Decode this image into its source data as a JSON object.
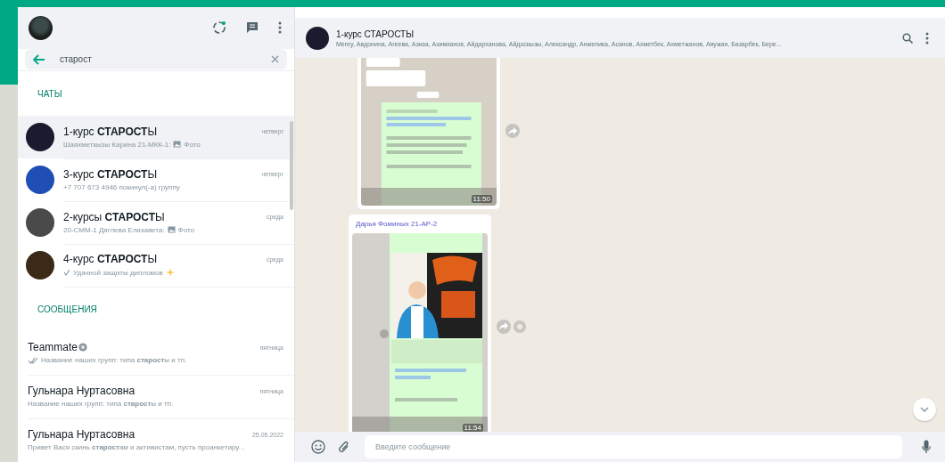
{
  "sidebar": {
    "search": {
      "value": "старост"
    },
    "sections": [
      {
        "title": "ЧАТЫ",
        "kind": "chats",
        "items": [
          {
            "name": "1-курс **СТАРОСТ**Ы",
            "time": "четверг",
            "selected": true,
            "color": "#1c1a2e",
            "sender": "Шаяхметкызы Карина 21-МКК-1: ",
            "photo": true,
            "text": "Фото"
          },
          {
            "name": "3-курс **СТАРОСТ**Ы",
            "time": "четверг",
            "selected": false,
            "color": "#1f4fb4",
            "text": "+7 707 673 4946 покинул(-а) группу"
          },
          {
            "name": "2-курсы **СТАРОСТ**Ы",
            "time": "среда",
            "selected": false,
            "color": "#4a4a4a",
            "sender": "20-СММ-1 Дяглева Елизавета: ",
            "photo": true,
            "text": "Фото"
          },
          {
            "name": "4-курс **СТАРОСТ**Ы",
            "time": "среда",
            "selected": false,
            "color": "#3b2a18",
            "sent_check": true,
            "text": "Удачной защиты дипломов",
            "sparkle": true
          }
        ]
      },
      {
        "title": "СООБЩЕНИЯ",
        "kind": "messages",
        "items": [
          {
            "name": "Teammate",
            "badge": true,
            "time": "пятница",
            "selected": false,
            "read_check": true,
            "text": "Название наших групп: типа **старост**ы и тп."
          },
          {
            "name": "Гульнара Нуртасовна",
            "time": "пятница",
            "selected": false,
            "text": "Название наших групп: типа **старост**ы и тп."
          },
          {
            "name": "Гульнара Нуртасовна",
            "time": "25.05.2022",
            "selected": false,
            "text": "Привет Вася скинь **старост**ам и активистам, пусть проанкетиру..."
          }
        ]
      }
    ]
  },
  "chat": {
    "title": "1-курс СТАРОСТЫ",
    "members": "Merey, Авдонина, Агеева, Азиза, Азимханов, Айдарханова, Айдоскызы, Александр, Анжелика, Асанов, Ахметбек, Ахметжанов, Аяужан, Базарбек, Бере...",
    "messages": [
      {
        "kind": "picture",
        "time": "11:50"
      },
      {
        "kind": "picture",
        "sender": "Дарья Фоминых 21-АР-2",
        "time": "11:54"
      }
    ]
  },
  "composer": {
    "placeholder": "Введите сообщение"
  }
}
